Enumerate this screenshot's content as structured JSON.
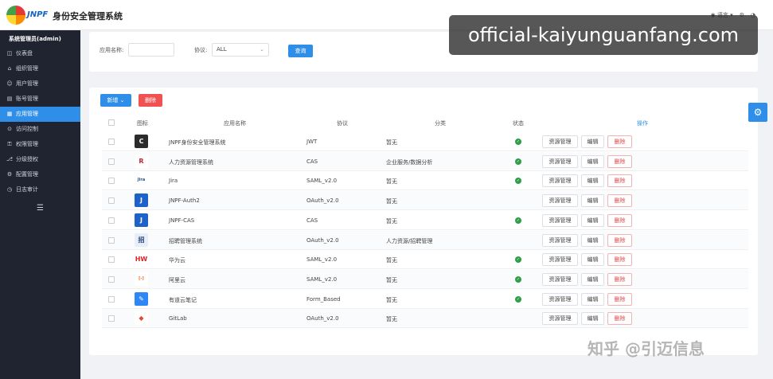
{
  "header": {
    "logo_text": "JNPF",
    "system_title": "身份安全管理系统",
    "lang_label": "语言",
    "settings_icon": "gear-icon",
    "user_icon": "user-icon"
  },
  "watermark": "official-kaiyunguanfang.com",
  "footer_watermark": "知乎 @引迈信息",
  "sidebar": {
    "admin_label": "系统管理员(admin)",
    "items": [
      {
        "label": "仪表盘",
        "icon": "dashboard-icon",
        "active": false
      },
      {
        "label": "组织管理",
        "icon": "org-icon",
        "active": false
      },
      {
        "label": "用户管理",
        "icon": "user-icon",
        "active": false
      },
      {
        "label": "账号管理",
        "icon": "account-icon",
        "active": false
      },
      {
        "label": "应用管理",
        "icon": "app-icon",
        "active": true
      },
      {
        "label": "访问控制",
        "icon": "access-icon",
        "active": false
      },
      {
        "label": "权限管理",
        "icon": "permission-icon",
        "active": false
      },
      {
        "label": "分级授权",
        "icon": "grant-icon",
        "active": false
      },
      {
        "label": "配置管理",
        "icon": "config-icon",
        "active": false
      },
      {
        "label": "日志审计",
        "icon": "log-icon",
        "active": false
      }
    ],
    "collapse_icon": "menu-collapse-icon"
  },
  "filter": {
    "app_name_label": "应用名称:",
    "app_name_value": "",
    "protocol_label": "协议:",
    "protocol_value": "ALL",
    "search_button": "查询"
  },
  "toolbar": {
    "add_button": "新增",
    "delete_button": "删除"
  },
  "table": {
    "headers": {
      "icon": "图标",
      "name": "应用名称",
      "protocol": "协议",
      "category": "分类",
      "status": "状态",
      "actions": "操作"
    },
    "action_labels": {
      "resource": "资源管理",
      "edit": "编辑",
      "delete": "删除"
    },
    "rows": [
      {
        "name": "JNPF身份安全管理系统",
        "protocol": "JWT",
        "category": "暂无",
        "status": true,
        "icon": "jnpf-app-icon",
        "icon_text": "C",
        "icon_bg": "#2b2b2b",
        "icon_color": "#ffffff"
      },
      {
        "name": "人力资源管理系统",
        "protocol": "CAS",
        "category": "企业服务/数据分析",
        "status": true,
        "icon": "hr-app-icon",
        "icon_text": "R",
        "icon_bg": "#ffffff",
        "icon_color": "#c0272d"
      },
      {
        "name": "Jira",
        "protocol": "SAML_v2.0",
        "category": "暂无",
        "status": true,
        "icon": "jira-app-icon",
        "icon_text": "Jira",
        "icon_bg": "#ffffff",
        "icon_color": "#1f4f8a"
      },
      {
        "name": "JNPF-Auth2",
        "protocol": "OAuth_v2.0",
        "category": "暂无",
        "status": false,
        "icon": "jnpf-auth2-app-icon",
        "icon_text": "J",
        "icon_bg": "#1e62c9",
        "icon_color": "#ffffff"
      },
      {
        "name": "JNPF-CAS",
        "protocol": "CAS",
        "category": "暂无",
        "status": true,
        "icon": "jnpf-cas-app-icon",
        "icon_text": "J",
        "icon_bg": "#1e62c9",
        "icon_color": "#ffffff"
      },
      {
        "name": "招聘管理系统",
        "protocol": "OAuth_v2.0",
        "category": "人力资源/招聘管理",
        "status": false,
        "icon": "recruit-app-icon",
        "icon_text": "招",
        "icon_bg": "#e8eef8",
        "icon_color": "#1f3f7a"
      },
      {
        "name": "华为云",
        "protocol": "SAML_v2.0",
        "category": "暂无",
        "status": true,
        "icon": "huawei-cloud-app-icon",
        "icon_text": "HW",
        "icon_bg": "#ffffff",
        "icon_color": "#d4262c"
      },
      {
        "name": "阿里云",
        "protocol": "SAML_v2.0",
        "category": "暂无",
        "status": true,
        "icon": "aliyun-app-icon",
        "icon_text": "[-]",
        "icon_bg": "#ffffff",
        "icon_color": "#f26a1b"
      },
      {
        "name": "有道云笔记",
        "protocol": "Form_Based",
        "category": "暂无",
        "status": true,
        "icon": "youdao-app-icon",
        "icon_text": "✎",
        "icon_bg": "#2f86f6",
        "icon_color": "#ffffff"
      },
      {
        "name": "GitLab",
        "protocol": "OAuth_v2.0",
        "category": "暂无",
        "status": false,
        "icon": "gitlab-app-icon",
        "icon_text": "◆",
        "icon_bg": "#ffffff",
        "icon_color": "#e2492f"
      }
    ]
  },
  "colors": {
    "primary": "#2f8fe8",
    "danger": "#f05252",
    "sidebar_bg": "#1f2430",
    "status_ok": "#2e9e47"
  }
}
